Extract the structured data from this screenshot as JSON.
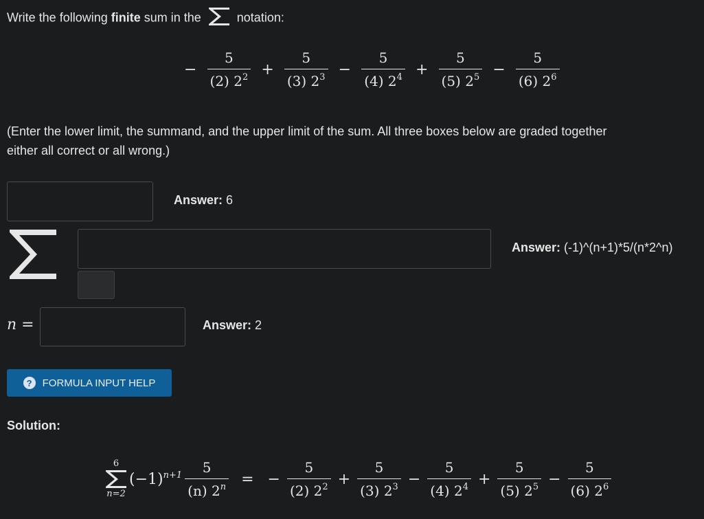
{
  "prompt": {
    "before": "Write the following ",
    "bold": "finite",
    "after_bold": " sum in the ",
    "after_sigma": " notation:"
  },
  "expression": {
    "terms": [
      {
        "sign": "−",
        "num": "5",
        "den_base": "(2) 2",
        "den_exp": "2"
      },
      {
        "sign": "+",
        "num": "5",
        "den_base": "(3) 2",
        "den_exp": "3"
      },
      {
        "sign": "−",
        "num": "5",
        "den_base": "(4) 2",
        "den_exp": "4"
      },
      {
        "sign": "+",
        "num": "5",
        "den_base": "(5) 2",
        "den_exp": "5"
      },
      {
        "sign": "−",
        "num": "5",
        "den_base": "(6) 2",
        "den_exp": "6"
      }
    ]
  },
  "note": {
    "line1": "(Enter the lower limit, the summand, and the upper limit of the sum. All three boxes below are graded together",
    "line2": "either all correct or all wrong.)"
  },
  "upper": {
    "value": "",
    "answer_label": "Answer:",
    "answer_value": " 6"
  },
  "summand": {
    "value": "",
    "answer_label": "Answer:",
    "answer_value": " (-1)^(n+1)*5/(n*2^n)"
  },
  "lower": {
    "label": "n =",
    "value": "",
    "answer_label": "Answer:",
    "answer_value": " 2"
  },
  "help_button": {
    "label": "FORMULA INPUT HELP",
    "icon": "question-icon"
  },
  "solution": {
    "label": "Solution:",
    "sum_upper": "6",
    "sum_lower": "n=2",
    "sum_factor": "(−1)",
    "sum_factor_exp": "n+1",
    "summand_num": "5",
    "summand_den_base": "(n) 2",
    "summand_den_exp": "n",
    "equals": "="
  },
  "colors": {
    "background": "#1b1c1e",
    "text": "#e6e6e6",
    "button": "#0f5f99",
    "input_border": "#4a4b4e"
  }
}
